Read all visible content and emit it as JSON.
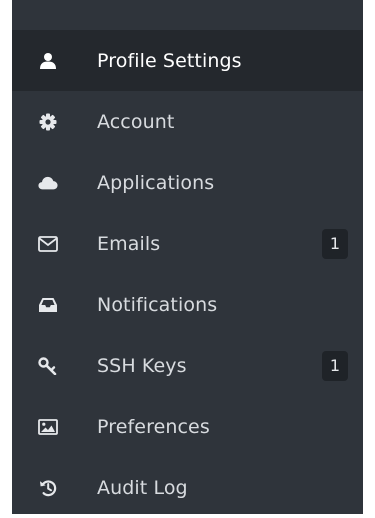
{
  "sidebar": {
    "items": [
      {
        "label": "Profile Settings",
        "icon": "user-icon",
        "active": true
      },
      {
        "label": "Account",
        "icon": "gear-icon"
      },
      {
        "label": "Applications",
        "icon": "cloud-icon"
      },
      {
        "label": "Emails",
        "icon": "envelope-icon",
        "badge": "1"
      },
      {
        "label": "Notifications",
        "icon": "inbox-icon"
      },
      {
        "label": "SSH Keys",
        "icon": "key-icon",
        "badge": "1"
      },
      {
        "label": "Preferences",
        "icon": "image-icon"
      },
      {
        "label": "Audit Log",
        "icon": "history-icon"
      }
    ]
  },
  "colors": {
    "sidebar_bg": "#2f343b",
    "active_bg": "#24282d",
    "text": "#d8dbdf",
    "badge_bg": "#1f2328"
  }
}
